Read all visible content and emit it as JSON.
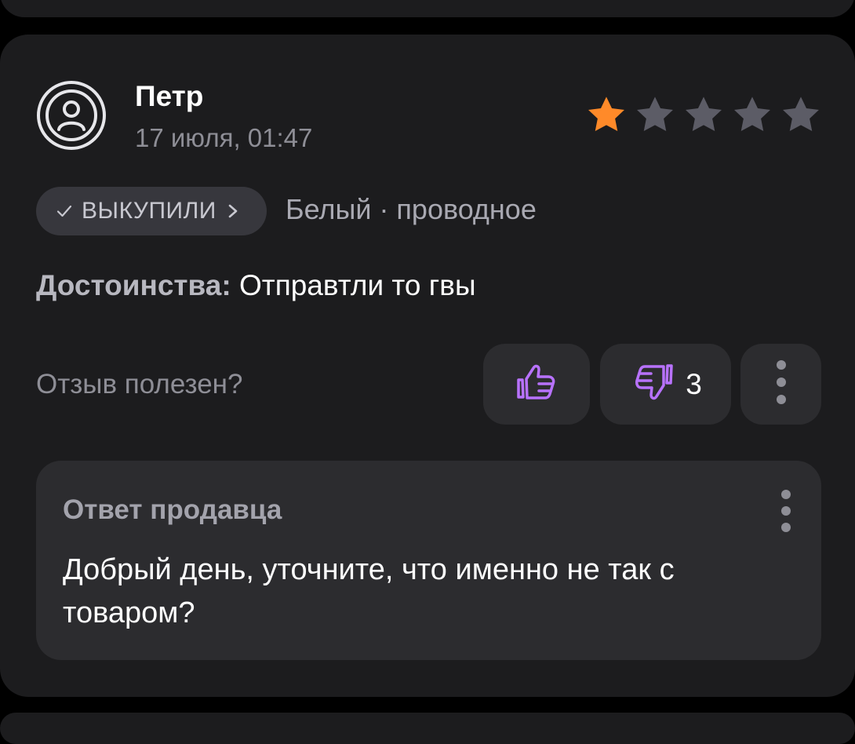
{
  "review": {
    "author": "Петр",
    "date": "17 июля, 01:47",
    "rating": 1,
    "max_rating": 5,
    "badge_label": "ВЫКУПИЛИ",
    "variant": "Белый · проводное",
    "pros_label": "Достоинства:",
    "pros_text": "Отправтли то гвы",
    "helpful_question": "Отзыв полезен?",
    "dislike_count": "3"
  },
  "seller_reply": {
    "title": "Ответ продавца",
    "text": "Добрый день, уточните, что именно не так с товаром?"
  },
  "colors": {
    "background": "#000000",
    "card": "#1c1c1e",
    "button": "#2c2c2f",
    "star_active": "#ff8a29",
    "star_inactive": "#5c5c66",
    "vote_icon": "#b872ff"
  },
  "icons": {
    "avatar": "user-circle-icon",
    "badge_check": "check-icon",
    "badge_arrow": "chevron-right-icon",
    "like": "thumb-up-icon",
    "dislike": "thumb-down-icon",
    "more": "more-vertical-icon"
  }
}
